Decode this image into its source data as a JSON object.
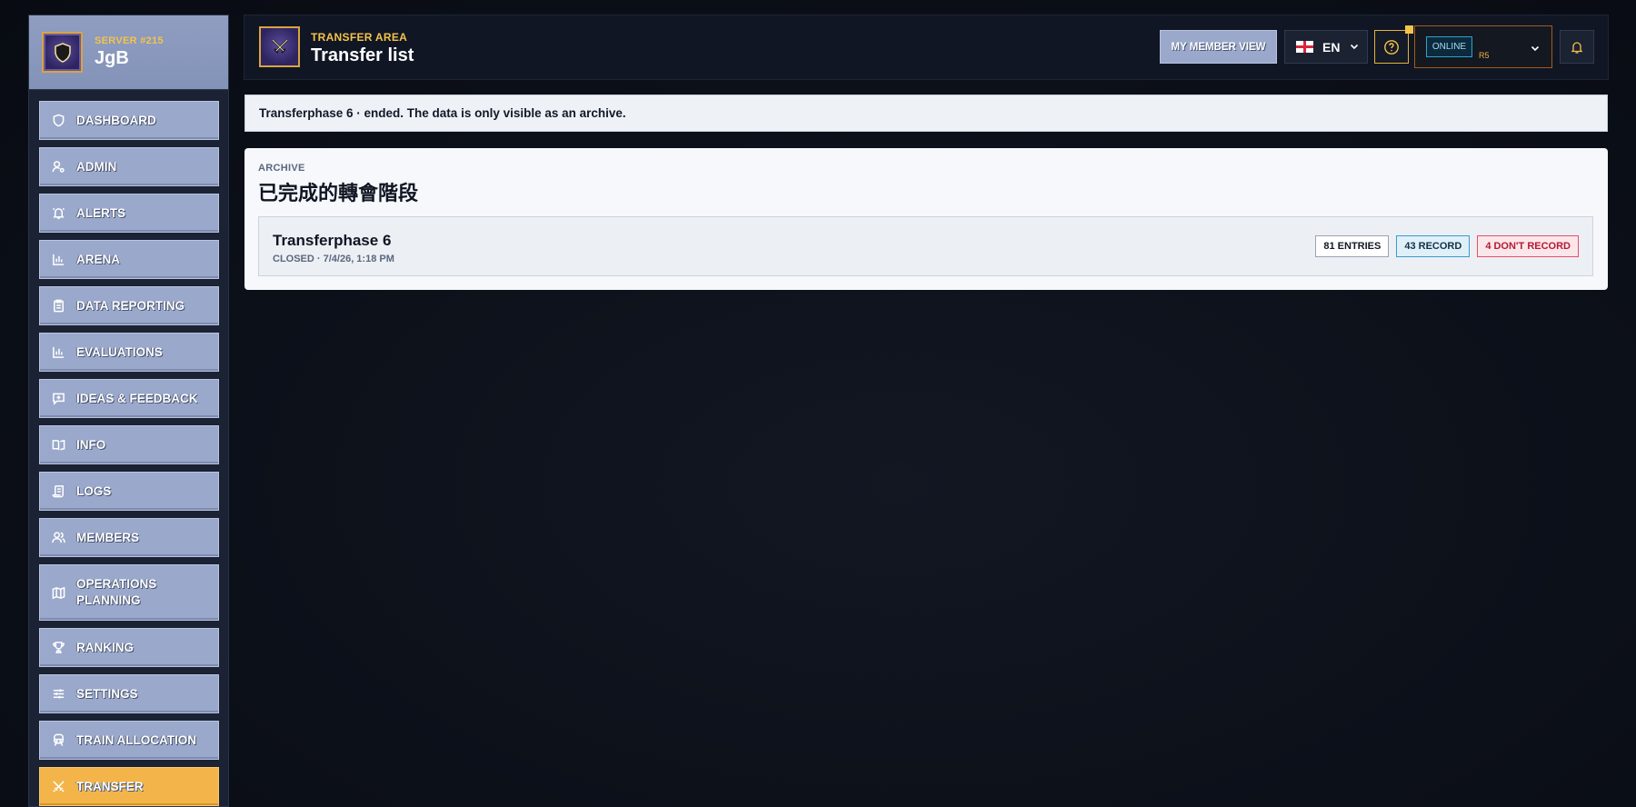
{
  "sidebar": {
    "server": "SERVER #215",
    "name": "JgB",
    "items": [
      {
        "label": "DASHBOARD",
        "icon": "shield-icon"
      },
      {
        "label": "ADMIN",
        "icon": "user-cog-icon"
      },
      {
        "label": "ALERTS",
        "icon": "bell-ring-icon"
      },
      {
        "label": "ARENA",
        "icon": "bar-chart-icon"
      },
      {
        "label": "DATA REPORTING",
        "icon": "clipboard-icon"
      },
      {
        "label": "EVALUATIONS",
        "icon": "bar-chart-icon"
      },
      {
        "label": "IDEAS & FEEDBACK",
        "icon": "message-plus-icon"
      },
      {
        "label": "INFO",
        "icon": "book-icon"
      },
      {
        "label": "LOGS",
        "icon": "scroll-icon"
      },
      {
        "label": "MEMBERS",
        "icon": "users-icon"
      },
      {
        "label": "OPERATIONS PLANNING",
        "icon": "map-icon"
      },
      {
        "label": "RANKING",
        "icon": "trophy-icon"
      },
      {
        "label": "SETTINGS",
        "icon": "sliders-icon"
      },
      {
        "label": "TRAIN ALLOCATION",
        "icon": "train-icon"
      },
      {
        "label": "TRANSFER",
        "icon": "swords-icon"
      }
    ],
    "active": "TRANSFER"
  },
  "header": {
    "eyebrow": "TRANSFER AREA",
    "title": "Transfer list",
    "member_view": "MY MEMBER VIEW",
    "language": "EN",
    "status": "ONLINE",
    "rank": "R5"
  },
  "notice": "Transferphase 6 · ended. The data is only visible as an archive.",
  "archive": {
    "eyebrow": "ARCHIVE",
    "title": "已完成的轉會階段",
    "phase": {
      "name": "Transferphase 6",
      "meta": "CLOSED · 7/4/26, 1:18 PM",
      "entries": "81 ENTRIES",
      "record": "43 RECORD",
      "no_record": "4 DON'T RECORD"
    }
  },
  "colors": {
    "accent": "#f4c34a",
    "nav_bg": "#9aa8cb",
    "active_bg": "#f3b54a",
    "record": "#3a9bd0",
    "no_record": "#e0516a"
  }
}
